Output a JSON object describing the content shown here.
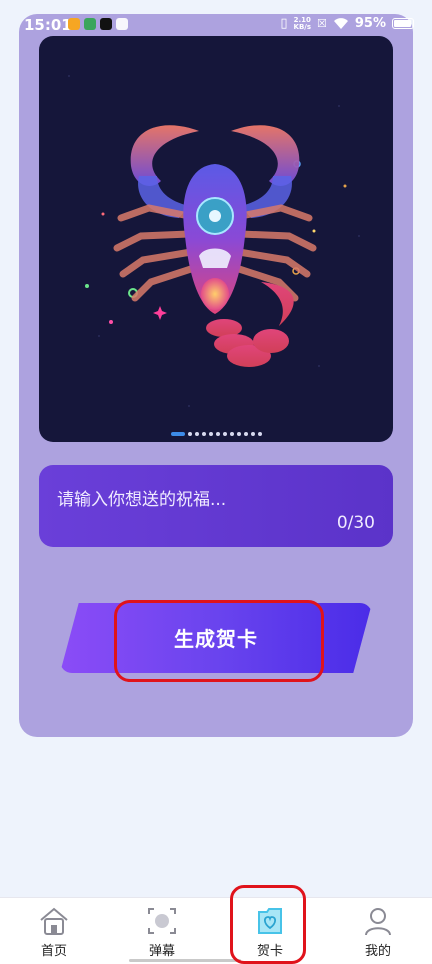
{
  "status_bar": {
    "time": "15:01",
    "net_speed_value": "2.10",
    "net_speed_unit": "KB/s",
    "battery": "95%"
  },
  "carousel": {
    "image_name": "scorpio-zodiac-illustration",
    "page_count": 12,
    "active_page": 1
  },
  "wish_input": {
    "placeholder": "请输入你想送的祝福...",
    "counter": "0/30"
  },
  "generate_button": {
    "label": "生成贺卡"
  },
  "bottom_nav": {
    "items": [
      {
        "label": "首页",
        "icon": "home-icon",
        "active": false
      },
      {
        "label": "弹幕",
        "icon": "barrage-icon",
        "active": false
      },
      {
        "label": "贺卡",
        "icon": "card-icon",
        "active": true
      },
      {
        "label": "我的",
        "icon": "profile-icon",
        "active": false
      }
    ]
  },
  "colors": {
    "page_bg": "#eef3fc",
    "card_bg": "#ada2df",
    "panel": "#6a3fd9",
    "button_start": "#8b4cf7",
    "button_end": "#4a2ce8",
    "highlight": "#e0131b",
    "active_icon": "#47c3e8"
  }
}
